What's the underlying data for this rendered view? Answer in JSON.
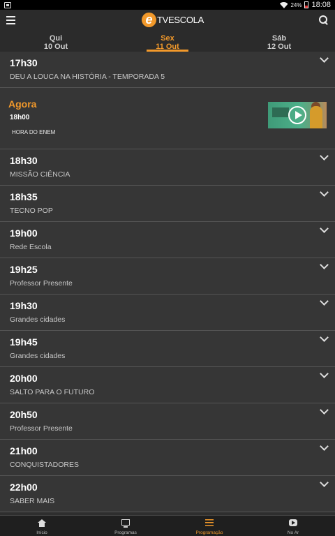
{
  "status_bar": {
    "battery": "24%",
    "time": "18:08"
  },
  "app": {
    "logo_text": "TVESCOLA"
  },
  "day_tabs": [
    {
      "name": "Qui",
      "date": "10 Out"
    },
    {
      "name": "Sex",
      "date": "11 Out"
    },
    {
      "name": "Sáb",
      "date": "12 Out"
    }
  ],
  "schedule_before": [
    {
      "time": "17h30",
      "title": "DEU A LOUCA NA HISTÓRIA - TEMPORADA 5"
    }
  ],
  "now": {
    "label": "Agora",
    "time": "18h00",
    "title": "HORA DO ENEM"
  },
  "schedule_after": [
    {
      "time": "18h30",
      "title": "MISSÃO CIÊNCIA"
    },
    {
      "time": "18h35",
      "title": "TECNO POP"
    },
    {
      "time": "19h00",
      "title": "Rede Escola"
    },
    {
      "time": "19h25",
      "title": "Professor Presente"
    },
    {
      "time": "19h30",
      "title": "Grandes cidades"
    },
    {
      "time": "19h45",
      "title": "Grandes cidades"
    },
    {
      "time": "20h00",
      "title": "SALTO PARA O FUTURO"
    },
    {
      "time": "20h50",
      "title": "Professor Presente"
    },
    {
      "time": "21h00",
      "title": "CONQUISTADORES"
    },
    {
      "time": "22h00",
      "title": "SABER MAIS"
    }
  ],
  "bottom_nav": [
    {
      "label": "Início",
      "icon": "home-icon"
    },
    {
      "label": "Programas",
      "icon": "tv-icon"
    },
    {
      "label": "Programação",
      "icon": "list-icon"
    },
    {
      "label": "No Ar",
      "icon": "youtube-icon"
    }
  ],
  "colors": {
    "accent": "#f2992b",
    "background": "#2e2e2e"
  }
}
